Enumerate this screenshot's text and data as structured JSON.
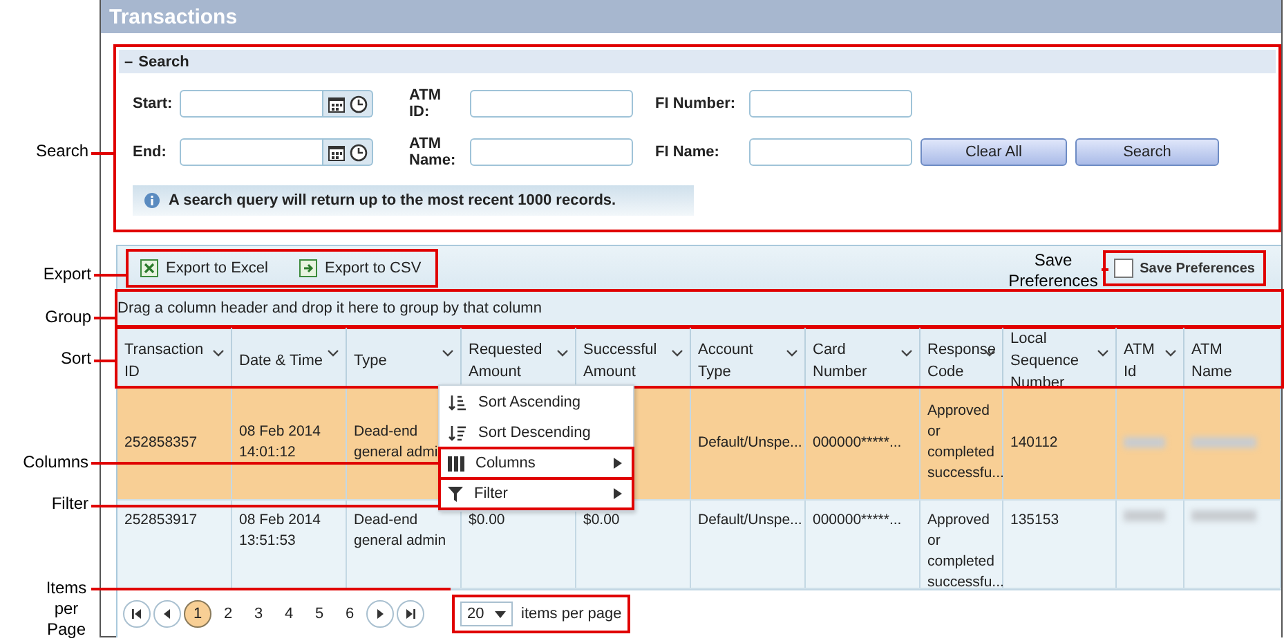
{
  "window": {
    "title": "Transactions"
  },
  "search": {
    "toggle": "–",
    "title": "Search",
    "fields": [
      {
        "label": "Start:",
        "kind": "datetime"
      },
      {
        "label": "ATM ID:",
        "kind": "text"
      },
      {
        "label": "FI Number:",
        "kind": "text"
      },
      {
        "label": "End:",
        "kind": "datetime"
      },
      {
        "label": "ATM Name:",
        "kind": "text"
      },
      {
        "label": "FI Name:",
        "kind": "text"
      }
    ],
    "buttons": [
      "Clear All",
      "Search"
    ],
    "info": "A search query will return up to the most recent 1000 records."
  },
  "toolbar": {
    "exports": [
      {
        "label": "Export to Excel",
        "kind": "excel"
      },
      {
        "label": "Export to CSV",
        "kind": "csv"
      }
    ],
    "save_preferences": {
      "label": "Save Preferences",
      "checked": false
    }
  },
  "group_bar": "Drag a column header and drop it here to group by that column",
  "table": {
    "columns": [
      "Transaction ID",
      "Date & Time",
      "Type",
      "Requested Amount",
      "Successful Amount",
      "Account Type",
      "Card Number",
      "Response Code",
      "Local Sequence Number",
      "ATM Id",
      "ATM Name"
    ],
    "rows": [
      {
        "selected": true,
        "cells": [
          "252858357",
          "08 Feb 2014 14:01:12",
          "Dead-end general admi",
          "",
          "",
          "Default/Unspe...",
          "000000*****...",
          "Approved or completed successfu...",
          "140112",
          null,
          null
        ]
      },
      {
        "selected": false,
        "cells": [
          "252853917",
          "08 Feb 2014 13:51:53",
          "Dead-end general admin",
          "$0.00",
          "$0.00",
          "Default/Unspe...",
          "000000*****...",
          "Approved or completed successfu...",
          "135153",
          null,
          null
        ]
      }
    ]
  },
  "context_menu": [
    {
      "label": "Sort Ascending",
      "kind": "sort-asc",
      "submenu": false
    },
    {
      "label": "Sort Descending",
      "kind": "sort-desc",
      "submenu": false
    },
    {
      "label": "Columns",
      "kind": "columns",
      "submenu": true
    },
    {
      "label": "Filter",
      "kind": "filter",
      "submenu": true
    }
  ],
  "pager": {
    "pages": [
      {
        "label": "1",
        "selected": true
      },
      {
        "label": "2",
        "selected": false
      },
      {
        "label": "3",
        "selected": false
      },
      {
        "label": "4",
        "selected": false
      },
      {
        "label": "5",
        "selected": false
      },
      {
        "label": "6",
        "selected": false
      }
    ],
    "page_size": "20",
    "page_size_label": "items per page"
  },
  "annotations": [
    {
      "label": "Search"
    },
    {
      "label": "Export"
    },
    {
      "label": "Group"
    },
    {
      "label": "Sort"
    },
    {
      "label": "Columns"
    },
    {
      "label": "Filter"
    },
    {
      "label": "Items per Page"
    },
    {
      "label": "Save Preferences"
    }
  ]
}
